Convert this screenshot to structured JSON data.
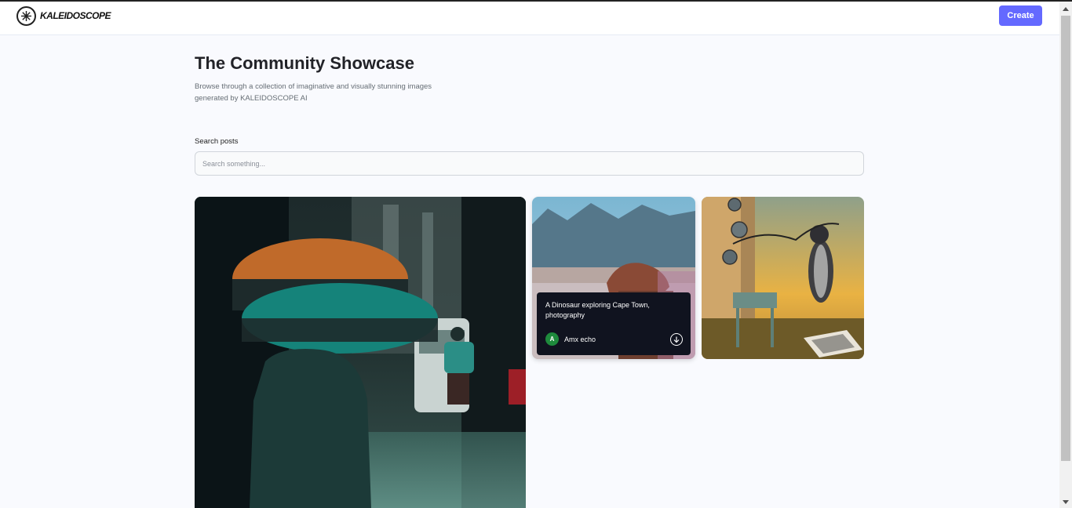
{
  "header": {
    "logo_text": "KALEIDOSCOPE",
    "create_label": "Create",
    "accent_color": "#6469ff"
  },
  "main": {
    "title": "The Community Showcase",
    "subtitle": "Browse through a collection of imaginative and visually stunning images generated by KALEIDOSCOPE AI",
    "search": {
      "label": "Search posts",
      "placeholder": "Search something..."
    }
  },
  "posts": [
    {
      "image": "rainy-street-umbrellas"
    },
    {
      "image": "dinosaur-cape-town",
      "prompt": "A Dinosaur exploring Cape Town, photography",
      "author_initial": "A",
      "author_name": "Amx echo",
      "avatar_color": "#1e8a3c",
      "icons": {
        "download": "download-icon"
      }
    },
    {
      "image": "surreal-cat-chess"
    }
  ]
}
